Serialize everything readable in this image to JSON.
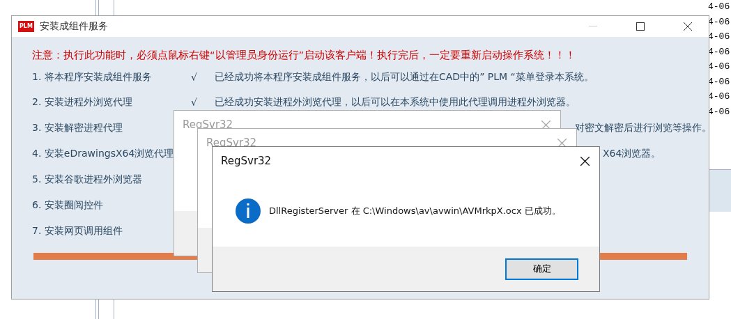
{
  "background_window": {
    "date_column": [
      "4-06",
      "4-06",
      "4-06",
      "4-06",
      "4-06",
      "4-06",
      "4-06",
      "4-06"
    ]
  },
  "window": {
    "title": "安装成组件服务",
    "logo": "PLM"
  },
  "notice": "注意：执行此功能时，必须点鼠标右键“以管理员身份运行”启动该客户端！执行完后，一定要重新启动操作系统！！！",
  "done_mark": "√",
  "steps": [
    {
      "label": "1. 将本程序安装成组件服务",
      "done": true,
      "message": "已经成功将本程序安装成组件服务，以后可以通过在CAD中的” PLM “菜单登录本系统。"
    },
    {
      "label": "2. 安装进程外浏览代理",
      "done": true,
      "message": "已经成功安装进程外浏览代理，以后可以在本系统中使用此代理调用进程外浏览器。"
    },
    {
      "label": "3. 安装解密进程代理",
      "done": false,
      "message": "对密文解密后进行浏览等操作。"
    },
    {
      "label": "4. 安装eDrawingsX64浏览代理",
      "done": false,
      "message": "X64浏览器。"
    },
    {
      "label": "5. 安装谷歌进程外浏览器",
      "done": false
    },
    {
      "label": "6. 安装圈阅控件",
      "done": false
    },
    {
      "label": "7. 安装网页调用组件",
      "done": false
    }
  ],
  "progress": {
    "level": 1
  },
  "dialogs": [
    {
      "title": "RegSvr32",
      "active": false
    },
    {
      "title": "RegSvr32",
      "active": false
    },
    {
      "title": "RegSvr32",
      "active": true,
      "message": "DllRegisterServer 在 C:\\Windows\\av\\avwin\\AVMrkpX.ocx 已成功。",
      "button": "确定"
    }
  ]
}
